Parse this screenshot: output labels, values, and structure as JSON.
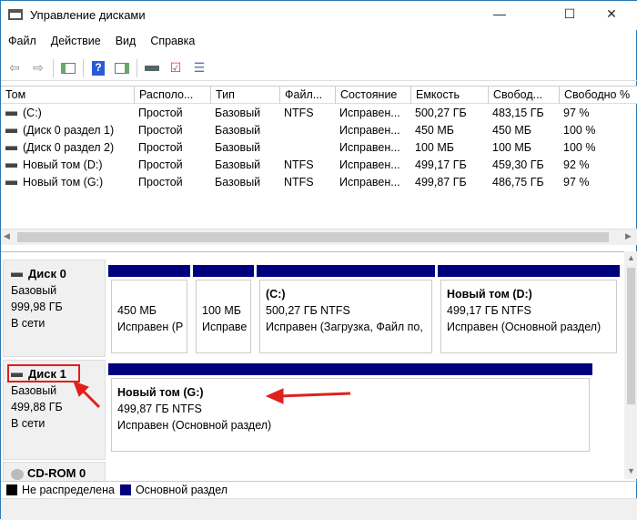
{
  "window": {
    "title": "Управление дисками",
    "min": "—",
    "max": "☐",
    "close": "✕"
  },
  "menu": [
    "Файл",
    "Действие",
    "Вид",
    "Справка"
  ],
  "toolbar": [
    "back-icon",
    "forward-icon",
    "console-tree-icon",
    "help-icon",
    "action-pane-icon",
    "connect-disk-icon",
    "check-icon",
    "properties-icon"
  ],
  "table": {
    "columns": [
      "Том",
      "Располо...",
      "Тип",
      "Файл...",
      "Состояние",
      "Емкость",
      "Свобод...",
      "Свободно %"
    ],
    "rows": [
      [
        "(C:)",
        "Простой",
        "Базовый",
        "NTFS",
        "Исправен...",
        "500,27 ГБ",
        "483,15 ГБ",
        "97 %"
      ],
      [
        "(Диск 0 раздел 1)",
        "Простой",
        "Базовый",
        "",
        "Исправен...",
        "450 МБ",
        "450 МБ",
        "100 %"
      ],
      [
        "(Диск 0 раздел 2)",
        "Простой",
        "Базовый",
        "",
        "Исправен...",
        "100 МБ",
        "100 МБ",
        "100 %"
      ],
      [
        "Новый том (D:)",
        "Простой",
        "Базовый",
        "NTFS",
        "Исправен...",
        "499,17 ГБ",
        "459,30 ГБ",
        "92 %"
      ],
      [
        "Новый том (G:)",
        "Простой",
        "Базовый",
        "NTFS",
        "Исправен...",
        "499,87 ГБ",
        "486,75 ГБ",
        "97 %"
      ]
    ]
  },
  "disks": [
    {
      "name": "Диск 0",
      "type": "Базовый",
      "size": "999,98 ГБ",
      "status": "В сети",
      "partitions": [
        {
          "title": "",
          "size": "450 МБ",
          "state": "Исправен (Р"
        },
        {
          "title": "",
          "size": "100 МБ",
          "state": "Исправе"
        },
        {
          "title": "(C:)",
          "size": "500,27 ГБ NTFS",
          "state": "Исправен (Загрузка, Файл по,"
        },
        {
          "title": "Новый том  (D:)",
          "size": "499,17 ГБ NTFS",
          "state": "Исправен (Основной раздел)"
        }
      ]
    },
    {
      "name": "Диск 1",
      "type": "Базовый",
      "size": "499,88 ГБ",
      "status": "В сети",
      "partitions": [
        {
          "title": "Новый том  (G:)",
          "size": "499,87 ГБ NTFS",
          "state": "Исправен (Основной раздел)"
        }
      ]
    }
  ],
  "cdrom": {
    "name": "CD-ROM 0"
  },
  "legend": [
    {
      "label": "Не распределена",
      "color": "#000000"
    },
    {
      "label": "Основной раздел",
      "color": "#00007f"
    }
  ],
  "annotation_color": "#e0201c"
}
